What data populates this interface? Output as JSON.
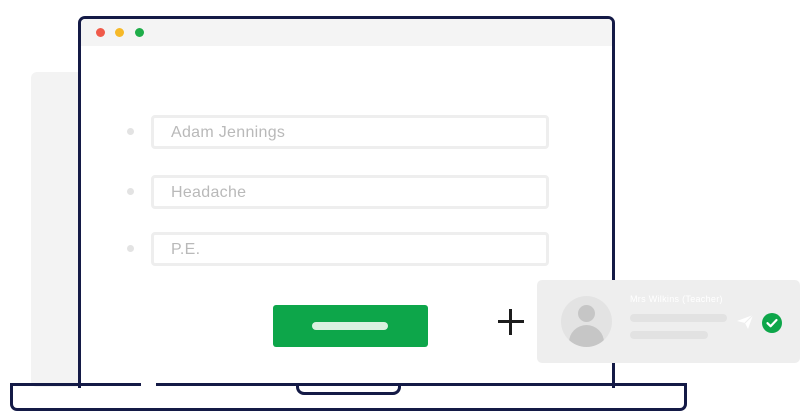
{
  "window": {
    "controls": [
      "close",
      "minimize",
      "maximize"
    ]
  },
  "form": {
    "fields": [
      {
        "value": "Adam Jennings"
      },
      {
        "value": "Headache"
      },
      {
        "value": "P.E."
      }
    ]
  },
  "notification": {
    "recipient": "Mrs Wilkins (Teacher)",
    "icons": [
      "avatar",
      "send-icon",
      "check-circle-icon"
    ]
  },
  "icons": [
    "plus-icon"
  ],
  "colors": {
    "laptop_outline": "#141a46",
    "accent_green": "#0da64a",
    "dot_red": "#f05a4a",
    "dot_yellow": "#f6b928",
    "dot_green": "#1fad49"
  }
}
